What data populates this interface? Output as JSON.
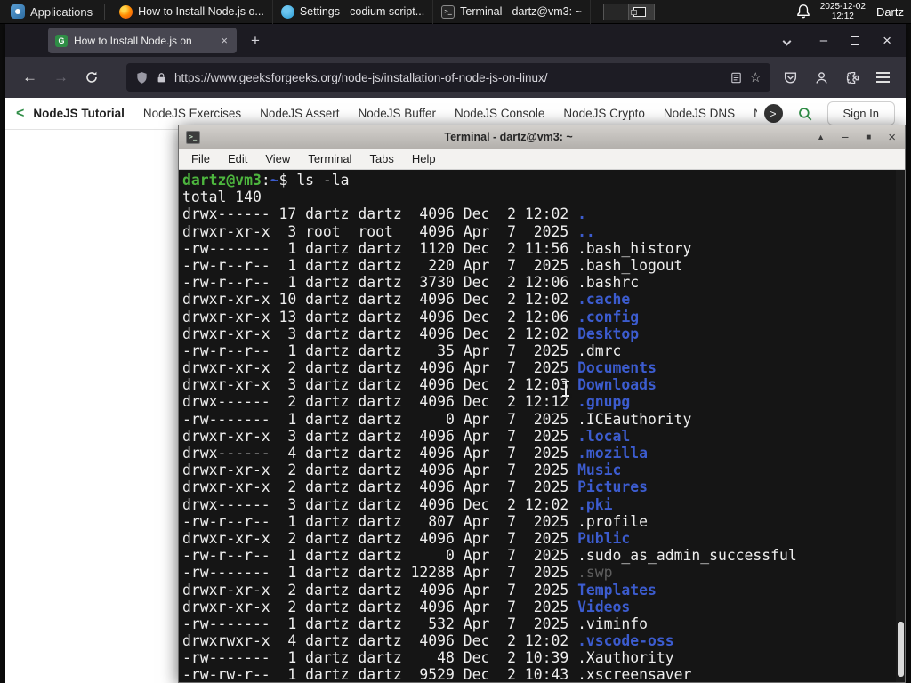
{
  "colors": {
    "panel_bg": "#191919",
    "firefox_dark": "#1c1b22",
    "gfg_green": "#2f8d46",
    "terminal_bg": "#151515",
    "terminal_fg": "#eeeeee",
    "prompt_green": "#4db63e",
    "dir_blue": "#3c5ccf",
    "dim_gray": "#5f5f5f"
  },
  "panel": {
    "applications": "Applications",
    "windows": [
      {
        "label": "How to Install Node.js o...",
        "icon": "firefox-icon"
      },
      {
        "label": "Settings - codium script...",
        "icon": "codium-icon"
      },
      {
        "label": "Terminal - dartz@vm3: ~",
        "icon": "terminal-icon"
      }
    ],
    "clock": {
      "date": "2025-12-02",
      "time": "12:12"
    },
    "user": "Dartz"
  },
  "browser": {
    "tab": {
      "title": "How to Install Node.js on"
    },
    "url": "https://www.geeksforgeeks.org/node-js/installation-of-node-js-on-linux/",
    "gfg": {
      "links": [
        "NodeJS Tutorial",
        "NodeJS Exercises",
        "NodeJS Assert",
        "NodeJS Buffer",
        "NodeJS Console",
        "NodeJS Crypto",
        "NodeJS DNS",
        "Node"
      ],
      "sign_in": "Sign In"
    }
  },
  "terminal": {
    "title": "Terminal - dartz@vm3: ~",
    "menu": [
      "File",
      "Edit",
      "View",
      "Terminal",
      "Tabs",
      "Help"
    ],
    "prompt": {
      "user_host": "dartz@vm3",
      "colon": ":",
      "path": "~",
      "symbol": "$",
      "command": "ls -la"
    },
    "total": "total 140",
    "listing": [
      {
        "pre": "drwx------ 17 dartz dartz  4096 Dec  2 12:02 ",
        "name": ".",
        "type": "dir"
      },
      {
        "pre": "drwxr-xr-x  3 root  root   4096 Apr  7  2025 ",
        "name": "..",
        "type": "dir"
      },
      {
        "pre": "-rw-------  1 dartz dartz  1120 Dec  2 11:56 ",
        "name": ".bash_history",
        "type": "file"
      },
      {
        "pre": "-rw-r--r--  1 dartz dartz   220 Apr  7  2025 ",
        "name": ".bash_logout",
        "type": "file"
      },
      {
        "pre": "-rw-r--r--  1 dartz dartz  3730 Dec  2 12:06 ",
        "name": ".bashrc",
        "type": "file"
      },
      {
        "pre": "drwxr-xr-x 10 dartz dartz  4096 Dec  2 12:02 ",
        "name": ".cache",
        "type": "dir"
      },
      {
        "pre": "drwxr-xr-x 13 dartz dartz  4096 Dec  2 12:06 ",
        "name": ".config",
        "type": "dir"
      },
      {
        "pre": "drwxr-xr-x  3 dartz dartz  4096 Dec  2 12:02 ",
        "name": "Desktop",
        "type": "dir"
      },
      {
        "pre": "-rw-r--r--  1 dartz dartz    35 Apr  7  2025 ",
        "name": ".dmrc",
        "type": "file"
      },
      {
        "pre": "drwxr-xr-x  2 dartz dartz  4096 Apr  7  2025 ",
        "name": "Documents",
        "type": "dir"
      },
      {
        "pre": "drwxr-xr-x  3 dartz dartz  4096 Dec  2 12:03 ",
        "name": "Downloads",
        "type": "dir"
      },
      {
        "pre": "drwx------  2 dartz dartz  4096 Dec  2 12:12 ",
        "name": ".gnupg",
        "type": "dir"
      },
      {
        "pre": "-rw-------  1 dartz dartz     0 Apr  7  2025 ",
        "name": ".ICEauthority",
        "type": "file"
      },
      {
        "pre": "drwxr-xr-x  3 dartz dartz  4096 Apr  7  2025 ",
        "name": ".local",
        "type": "dir"
      },
      {
        "pre": "drwx------  4 dartz dartz  4096 Apr  7  2025 ",
        "name": ".mozilla",
        "type": "dir"
      },
      {
        "pre": "drwxr-xr-x  2 dartz dartz  4096 Apr  7  2025 ",
        "name": "Music",
        "type": "dir"
      },
      {
        "pre": "drwxr-xr-x  2 dartz dartz  4096 Apr  7  2025 ",
        "name": "Pictures",
        "type": "dir"
      },
      {
        "pre": "drwx------  3 dartz dartz  4096 Dec  2 12:02 ",
        "name": ".pki",
        "type": "dir"
      },
      {
        "pre": "-rw-r--r--  1 dartz dartz   807 Apr  7  2025 ",
        "name": ".profile",
        "type": "file"
      },
      {
        "pre": "drwxr-xr-x  2 dartz dartz  4096 Apr  7  2025 ",
        "name": "Public",
        "type": "dir"
      },
      {
        "pre": "-rw-r--r--  1 dartz dartz     0 Apr  7  2025 ",
        "name": ".sudo_as_admin_successful",
        "type": "file"
      },
      {
        "pre": "-rw-------  1 dartz dartz 12288 Apr  7  2025 ",
        "name": ".swp",
        "type": "dim"
      },
      {
        "pre": "drwxr-xr-x  2 dartz dartz  4096 Apr  7  2025 ",
        "name": "Templates",
        "type": "dir"
      },
      {
        "pre": "drwxr-xr-x  2 dartz dartz  4096 Apr  7  2025 ",
        "name": "Videos",
        "type": "dir"
      },
      {
        "pre": "-rw-------  1 dartz dartz   532 Apr  7  2025 ",
        "name": ".viminfo",
        "type": "file"
      },
      {
        "pre": "drwxrwxr-x  4 dartz dartz  4096 Dec  2 12:02 ",
        "name": ".vscode-oss",
        "type": "dir"
      },
      {
        "pre": "-rw-------  1 dartz dartz    48 Dec  2 10:39 ",
        "name": ".Xauthority",
        "type": "file"
      },
      {
        "pre": "-rw-rw-r--  1 dartz dartz  9529 Dec  2 10:43 ",
        "name": ".xscreensaver",
        "type": "file"
      }
    ]
  }
}
